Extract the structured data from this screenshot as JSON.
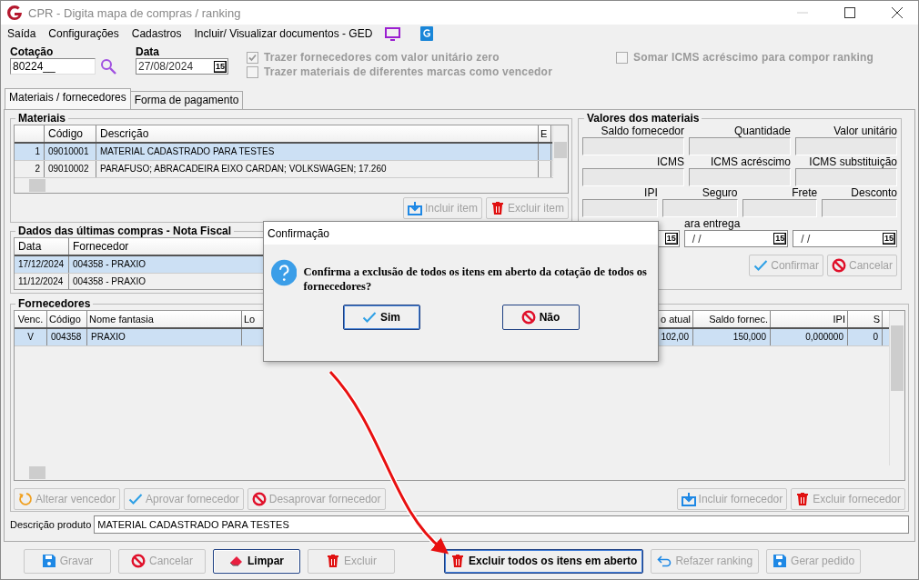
{
  "window": {
    "title": "CPR - Digita mapa de compras / ranking"
  },
  "menu": [
    {
      "label": "Saída"
    },
    {
      "label": "Configurações"
    },
    {
      "label": "Cadastros"
    },
    {
      "label": "Incluir/ Visualizar documentos - GED"
    }
  ],
  "header": {
    "cotacao": {
      "label": "Cotação",
      "value": "80224__"
    },
    "data": {
      "label": "Data",
      "value": "27/08/2024",
      "button": "15"
    },
    "options": [
      {
        "label": "Trazer fornecedores com valor unitário zero",
        "checked": true
      },
      {
        "label": "Trazer materiais de diferentes marcas como vencedor",
        "checked": false
      },
      {
        "label": "Somar ICMS acréscimo para compor ranking",
        "checked": false
      }
    ]
  },
  "tabs": [
    {
      "label": "Materiais / fornecedores",
      "selected": true
    },
    {
      "label": "Forma de pagamento",
      "selected": false
    }
  ],
  "materiais": {
    "title": "Materiais",
    "columns": [
      "Código",
      "Descrição",
      "E"
    ],
    "rows": [
      {
        "num": "1",
        "codigo": "09010001",
        "descricao": "MATERIAL CADASTRADO PARA TESTES",
        "selected": true
      },
      {
        "num": "2",
        "codigo": "09010002",
        "descricao": "PARAFUSO; ABRACADEIRA EIXO CARDAN; VOLKSWAGEN; 17.260",
        "selected": false
      }
    ],
    "buttons": [
      {
        "label": "Incluir item",
        "kind": "download",
        "disabled": true
      },
      {
        "label": "Excluir item",
        "kind": "trash",
        "disabled": true
      }
    ]
  },
  "ultimas_compras": {
    "title": "Dados das últimas compras - Nota Fiscal",
    "columns": [
      "Data",
      "Fornecedor"
    ],
    "rows": [
      {
        "data": "17/12/2024",
        "fornecedor": "004358 - PRAXIO",
        "selected": true
      },
      {
        "data": "11/12/2024",
        "fornecedor": "004358 - PRAXIO",
        "selected": false
      }
    ]
  },
  "valores": {
    "title": "Valores dos materiais",
    "field_rows": [
      [
        "Saldo fornecedor",
        "Quantidade",
        "Valor unitário"
      ],
      [
        "ICMS",
        "ICMS acréscimo",
        "ICMS substituição"
      ],
      [
        "IPI",
        "Seguro",
        "Frete",
        "Desconto"
      ]
    ],
    "entrega_label": "ara entrega",
    "dates": [
      {
        "button": "15"
      },
      {
        "value": "/ /",
        "button": "15"
      },
      {
        "value": "/ /",
        "button": "15"
      }
    ],
    "buttons": [
      {
        "label": "Confirmar",
        "kind": "check",
        "disabled": true
      },
      {
        "label": "Cancelar",
        "kind": "no",
        "disabled": true
      }
    ]
  },
  "fornecedores": {
    "title": "Fornecedores",
    "columns": [
      "Venc.",
      "Código",
      "Nome fantasia",
      "Lo",
      "o atual",
      "Saldo fornec.",
      "IPI",
      "S"
    ],
    "rows": [
      {
        "cells": [
          "V",
          "004358",
          "PRAXIO",
          "",
          "102,00",
          "150,000",
          "0,000000",
          "0"
        ],
        "selected": true
      }
    ],
    "buttons_left": [
      {
        "label": "Alterar vencedor",
        "kind": "refresh",
        "disabled": true
      },
      {
        "label": "Aprovar fornecedor",
        "kind": "check",
        "disabled": true
      },
      {
        "label": "Desaprovar fornecedor",
        "kind": "no",
        "disabled": true
      }
    ],
    "buttons_right": [
      {
        "label": "Incluir fornecedor",
        "kind": "download",
        "disabled": true
      },
      {
        "label": "Excluir fornecedor",
        "kind": "trash",
        "disabled": true
      }
    ]
  },
  "descricao_produto": {
    "label": "Descrição produto",
    "value": "MATERIAL CADASTRADO PARA TESTES"
  },
  "bottom_buttons": [
    {
      "label": "Gravar",
      "kind": "save",
      "disabled": true,
      "focused": false
    },
    {
      "label": "Cancelar",
      "kind": "no",
      "disabled": true,
      "focused": false
    },
    {
      "label": "Limpar",
      "kind": "eraser",
      "disabled": false,
      "focused": false
    },
    {
      "label": "Excluir",
      "kind": "trash",
      "disabled": true,
      "focused": false
    },
    {
      "label": "Excluir todos os itens em aberto",
      "kind": "trash",
      "disabled": false,
      "focused": true
    },
    {
      "label": "Refazer ranking",
      "kind": "undo",
      "disabled": true,
      "focused": false
    },
    {
      "label": "Gerar pedido",
      "kind": "save",
      "disabled": true,
      "focused": false
    }
  ],
  "dialog": {
    "title": "Confirmação",
    "message": "Confirma a exclusão de todos os itens em aberto da cotação de todos os fornecedores?",
    "buttons": [
      {
        "label": "Sim",
        "kind": "check",
        "default": true
      },
      {
        "label": "Não",
        "kind": "no",
        "default": false
      }
    ]
  }
}
